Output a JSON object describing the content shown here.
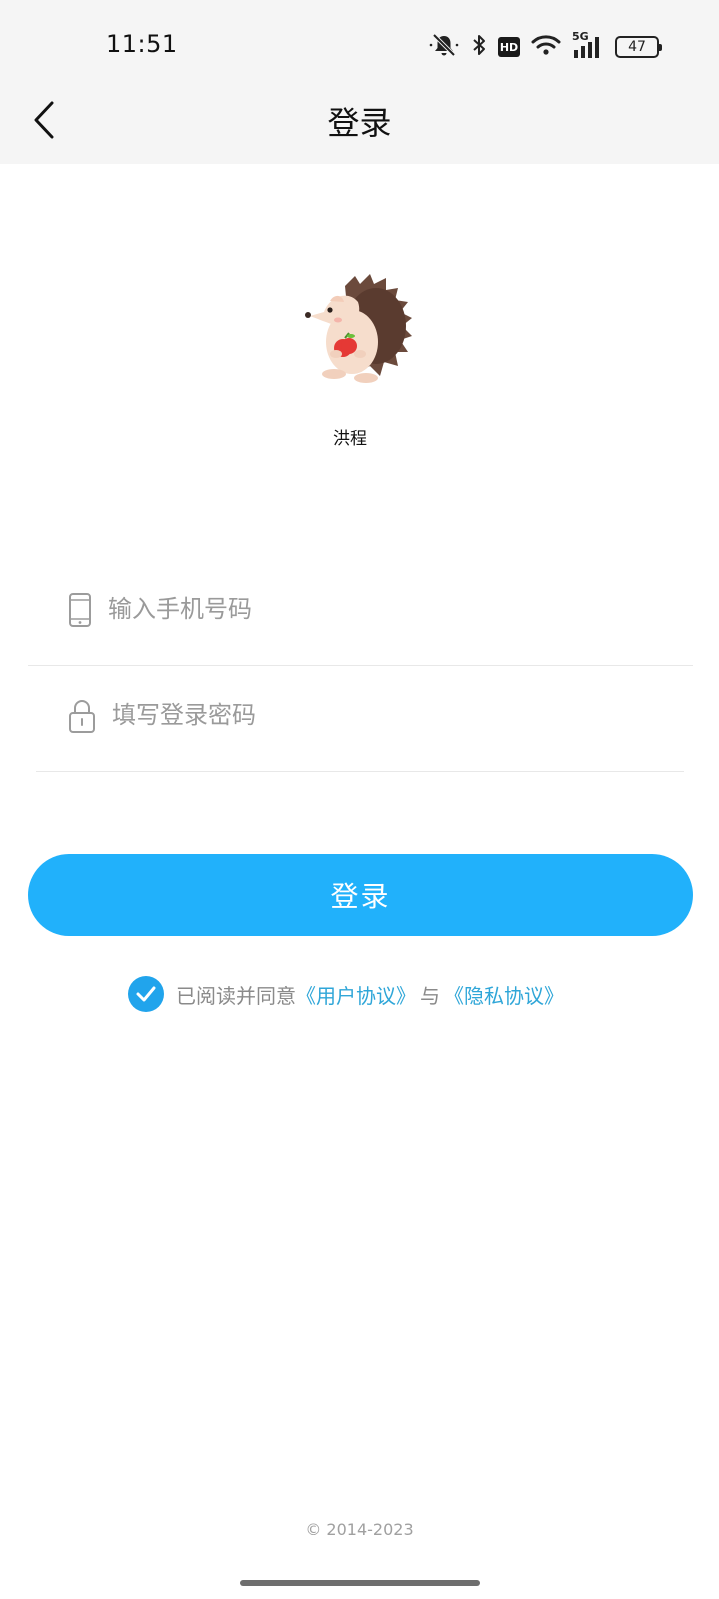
{
  "status_bar": {
    "time": "11:51",
    "network": "5G",
    "hd_badge": "HD",
    "battery": "47",
    "icons": [
      "mute-bell-icon",
      "bluetooth-icon",
      "hd-icon",
      "wifi-icon",
      "signal-icon",
      "battery-icon"
    ]
  },
  "header": {
    "title": "登录",
    "back_icon": "chevron-left-icon"
  },
  "brand": {
    "name": "洪程",
    "avatar_icon": "hedgehog-mascot"
  },
  "form": {
    "phone": {
      "placeholder": "输入手机号码",
      "value": "",
      "icon": "phone-icon"
    },
    "password": {
      "placeholder": "填写登录密码",
      "value": "",
      "icon": "lock-icon"
    },
    "submit_label": "登录"
  },
  "agreement": {
    "checked": true,
    "prefix": "已阅读并同意",
    "user_agreement": "《用户协议》",
    "conjunction": "与",
    "privacy_policy": "《隐私协议》"
  },
  "footer": {
    "copyright": "© 2014-2023"
  },
  "colors": {
    "accent": "#21b1fb",
    "link": "#2fa6d8",
    "header_bg": "#f5f5f5"
  }
}
